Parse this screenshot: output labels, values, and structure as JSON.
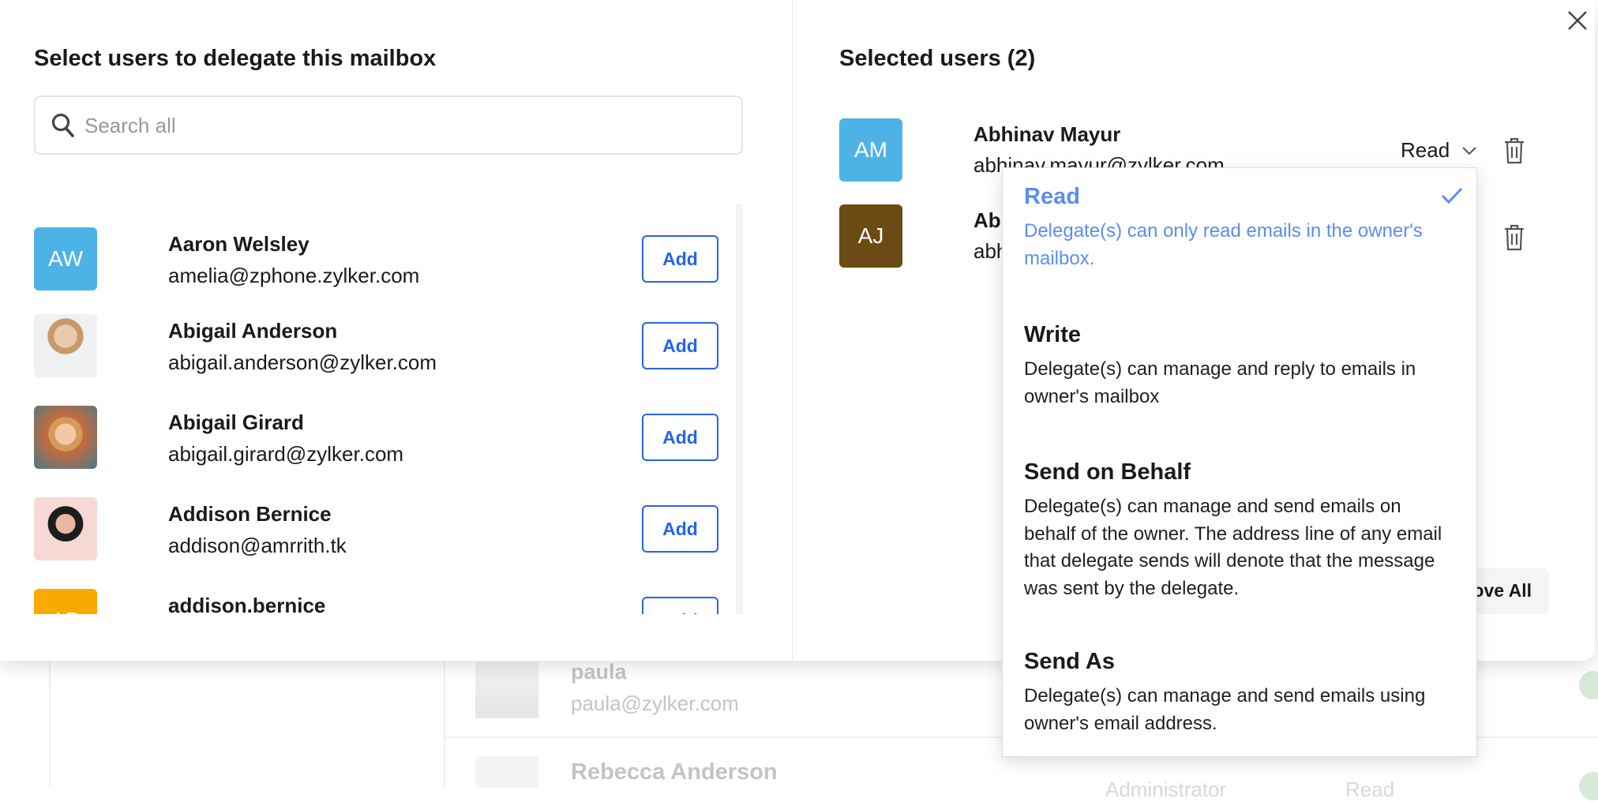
{
  "background": {
    "rows": [
      {
        "name": "paula",
        "email": "paula@zylker.com"
      },
      {
        "name": "Rebecca Anderson",
        "role": "Administrator",
        "access": "Read"
      }
    ]
  },
  "left_panel": {
    "title": "Select users to delegate this mailbox",
    "search": {
      "placeholder": "Search all",
      "value": "",
      "icon": "search-icon"
    },
    "add_label": "Add",
    "users": [
      {
        "initials": "AW",
        "name": "Aaron Welsley",
        "email": "amelia@zphone.zylker.com",
        "color": "#4db3e6"
      },
      {
        "initials": "",
        "name": "Abigail Anderson",
        "email": "abigail.anderson@zylker.com",
        "photo": true
      },
      {
        "initials": "",
        "name": "Abigail Girard",
        "email": "abigail.girard@zylker.com",
        "photo": true
      },
      {
        "initials": "",
        "name": "Addison Bernice",
        "email": "addison@amrrith.tk",
        "photo": true
      },
      {
        "initials": "AB",
        "name": "addison.bernice",
        "email": "",
        "color": "#f8aa00"
      }
    ]
  },
  "right_panel": {
    "title": "Selected users (2)",
    "users": [
      {
        "initials": "AM",
        "name": "Abhinav Mayur",
        "email": "abhinav.mayur@zylker.com",
        "color": "#4db3e6",
        "permission": "Read"
      },
      {
        "initials": "AJ",
        "name": "Ab",
        "email": "abh",
        "color": "#6b4a14"
      }
    ],
    "remove_all_label": "Remove All"
  },
  "permission_dropdown": {
    "selected": "Read",
    "accent": "#5b8def",
    "options": [
      {
        "title": "Read",
        "description": "Delegate(s) can only read emails in the owner's mailbox."
      },
      {
        "title": "Write",
        "description": "Delegate(s) can manage and reply to emails in owner's mailbox"
      },
      {
        "title": "Send on Behalf",
        "description": "Delegate(s) can manage and send emails on behalf of the owner. The address line of any email that delegate sends will denote that the message was sent by the delegate."
      },
      {
        "title": "Send As",
        "description": "Delegate(s) can manage and send emails using owner's email address."
      }
    ]
  }
}
